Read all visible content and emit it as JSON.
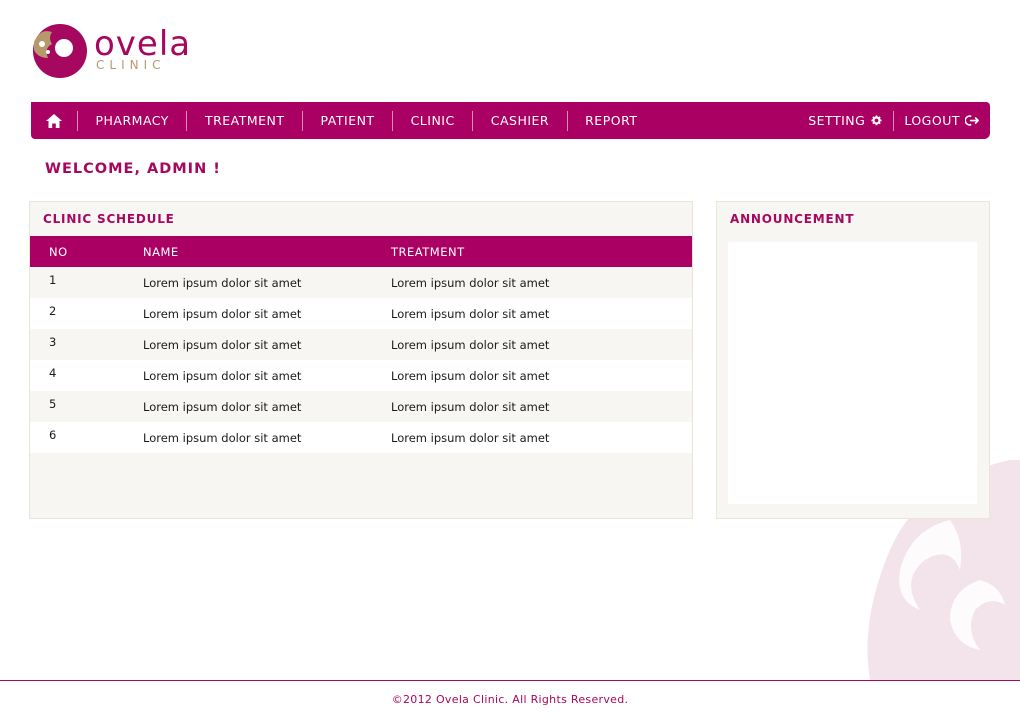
{
  "logo": {
    "word": "ovela",
    "sub": "CLINIC"
  },
  "nav": {
    "home_icon": "home-icon",
    "items": [
      {
        "label": "PHARMACY"
      },
      {
        "label": "TREATMENT"
      },
      {
        "label": "PATIENT"
      },
      {
        "label": "CLINIC"
      },
      {
        "label": "CASHIER"
      },
      {
        "label": "REPORT"
      }
    ],
    "setting_label": "SETTING",
    "setting_icon": "gear-icon",
    "logout_label": "LOGOUT",
    "logout_icon": "logout-icon"
  },
  "welcome": "WELCOME, ADMIN !",
  "schedule": {
    "title": "CLINIC SCHEDULE",
    "columns": [
      "NO",
      "NAME",
      "TREATMENT"
    ],
    "rows": [
      {
        "no": "1",
        "name": "Lorem ipsum dolor sit amet",
        "treatment": "Lorem ipsum dolor sit amet"
      },
      {
        "no": "2",
        "name": "Lorem ipsum dolor sit amet",
        "treatment": "Lorem ipsum dolor sit amet"
      },
      {
        "no": "3",
        "name": "Lorem ipsum dolor sit amet",
        "treatment": "Lorem ipsum dolor sit amet"
      },
      {
        "no": "4",
        "name": "Lorem ipsum dolor sit amet",
        "treatment": "Lorem ipsum dolor sit amet"
      },
      {
        "no": "5",
        "name": "Lorem ipsum dolor sit amet",
        "treatment": "Lorem ipsum dolor sit amet"
      },
      {
        "no": "6",
        "name": "Lorem ipsum dolor sit amet",
        "treatment": "Lorem ipsum dolor sit amet"
      },
      {
        "no": "",
        "name": "",
        "treatment": ""
      }
    ]
  },
  "announcement": {
    "title": "ANNOUNCEMENT"
  },
  "footer": "©2012 Ovela Clinic. All Rights Reserved.",
  "colors": {
    "brand": "#ab0063",
    "accent_gold": "#b79a6b",
    "panel_bg": "#f8f6f2"
  }
}
